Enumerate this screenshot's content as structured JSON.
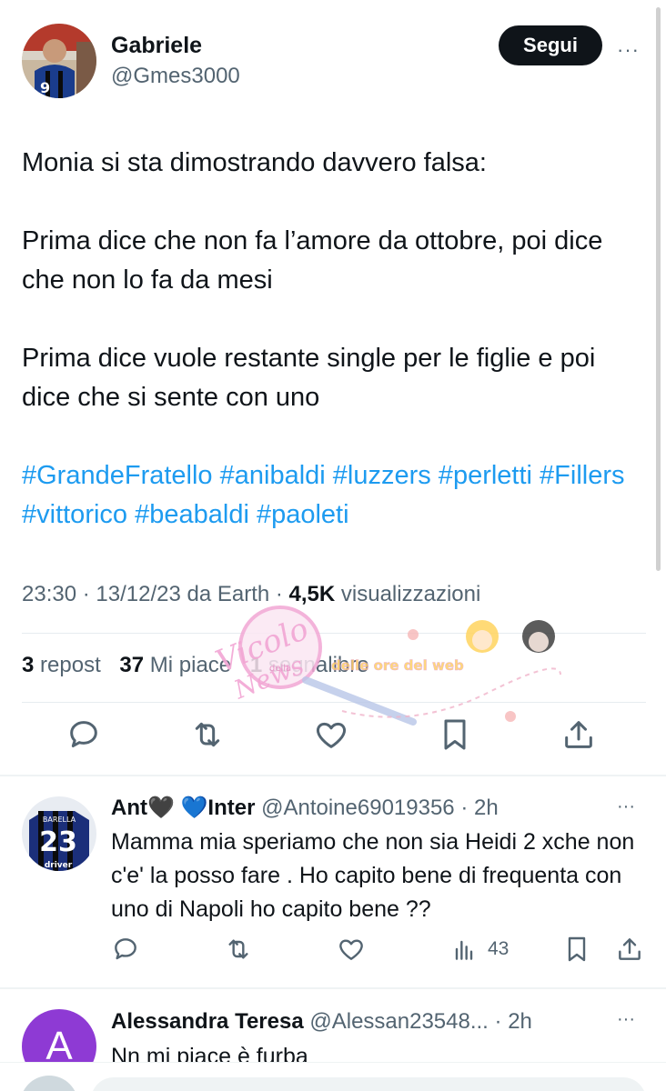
{
  "post": {
    "author_name": "Gabriele",
    "author_handle": "@Gmes3000",
    "follow_label": "Segui",
    "more_label": "···",
    "text_lines": [
      "Monia si sta dimostrando davvero falsa:",
      "Prima dice che non fa l’amore da ottobre, poi dice che non lo fa da mesi",
      "Prima dice vuole restante single per le figlie e poi dice che si sente con uno"
    ],
    "hashtags": "#GrandeFratello #anibaldi #luzzers #perletti #Fillers #vittorico #beabaldi #paoleti",
    "meta_time": "23:30 · 13/12/23 da Earth · ",
    "meta_views_count": "4,5K",
    "meta_views_label": " visualizzazioni",
    "reposts_count": "3",
    "reposts_label": "repost",
    "likes_count": "37",
    "likes_label": "Mi piace",
    "bookmarks_count": "1",
    "bookmarks_label": "segnalibro"
  },
  "watermark": {
    "text_script": "Vicolo",
    "text_script2": "News",
    "text_small": "della",
    "text_banner": "delle ore del web"
  },
  "replies": [
    {
      "name": "Ant🖤 💙Inter",
      "handle": "@Antoine69019356",
      "time": "· 2h",
      "text": "Mamma mia speriamo che non sia Heidi 2 xche non c'e' la posso fare . Ho capito bene di frequenta con uno di Napoli ho capito bene ??",
      "views": "43",
      "jersey_name": "BARELLA",
      "jersey_number": "23",
      "jersey_sponsor": "driver"
    },
    {
      "name": "Alessandra Teresa",
      "handle": "@Alessan23548...",
      "time": "· 2h",
      "text": "Nn mi piace è furba",
      "avatar_letter": "A"
    }
  ],
  "colors": {
    "accent": "#1d9bf0",
    "text": "#0f1419",
    "secondary": "#536471",
    "avatar_purple": "#8e3ad4"
  },
  "icons": [
    "reply-icon",
    "repost-icon",
    "like-icon",
    "bookmark-icon",
    "share-icon",
    "views-icon",
    "more-icon"
  ]
}
